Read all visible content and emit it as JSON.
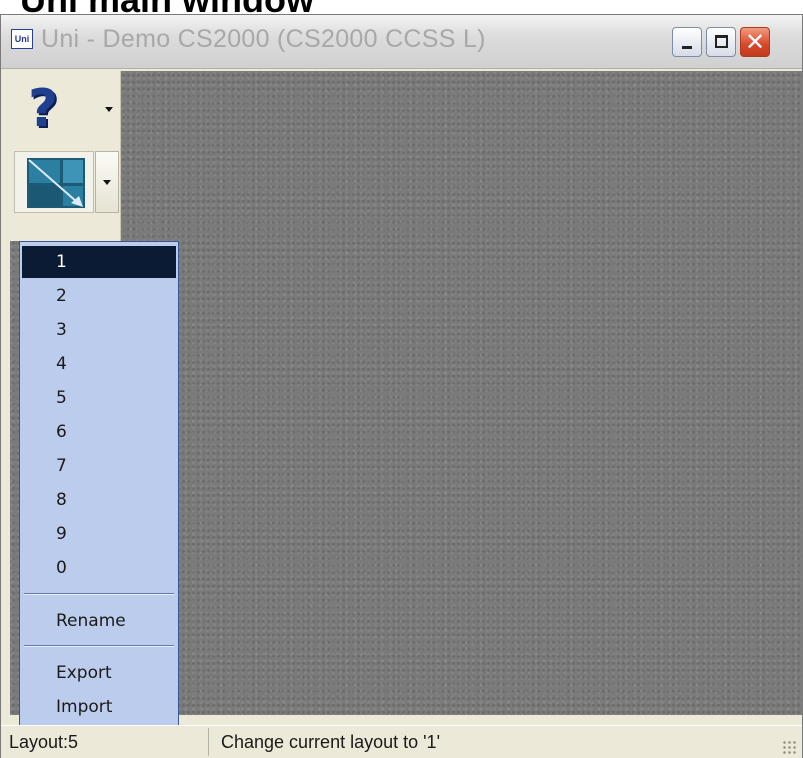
{
  "page_heading": "Uni main window",
  "window": {
    "icon_label": "Uni",
    "title": "Uni - Demo CS2000 (CS2000 CCSS  L)"
  },
  "toolbar": {
    "help_button_glyph": "?",
    "help_button_icon": "question-mark-icon",
    "layout_button_icon": "layout-icon"
  },
  "layout_menu": {
    "items": [
      "1",
      "2",
      "3",
      "4",
      "5",
      "6",
      "7",
      "8",
      "9",
      "0"
    ],
    "selected": "1",
    "rename_label": "Rename",
    "export_label": "Export",
    "import_label": "Import"
  },
  "status_bar": {
    "layout_text": "Layout:5",
    "message_text": "Change current layout to '1'"
  },
  "colors": {
    "menu_background": "#bcccec",
    "selected_item": "#0b1b33",
    "close_button": "#d8482a",
    "desktop": "#7a7a7a"
  }
}
